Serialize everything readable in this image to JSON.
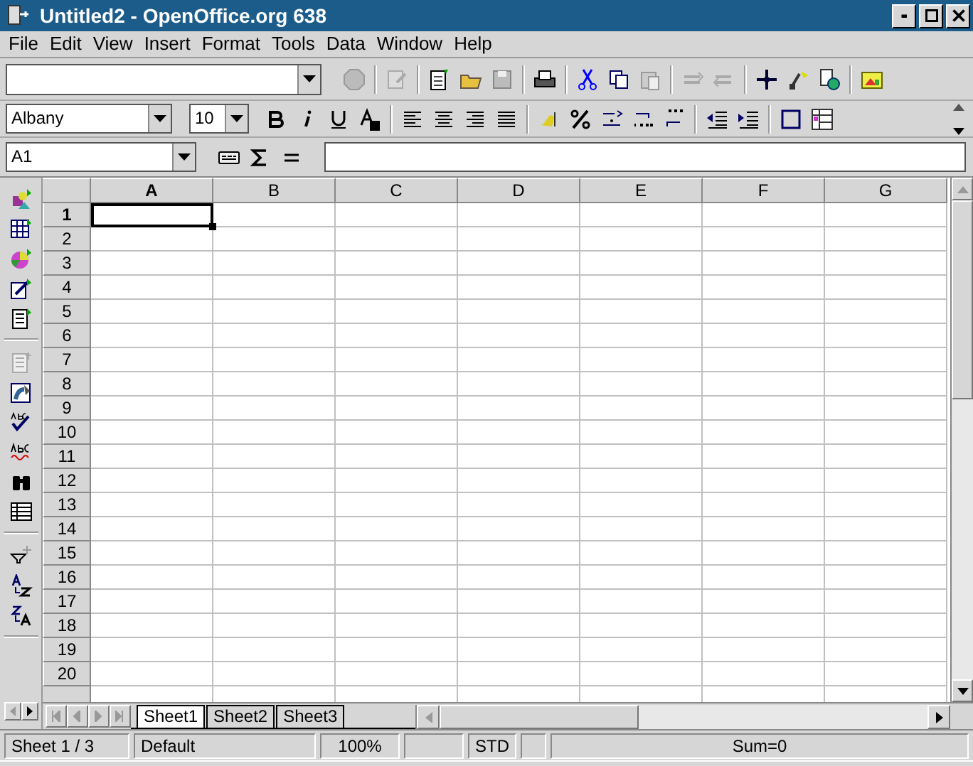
{
  "window": {
    "title": "Untitled2 - OpenOffice.org 638"
  },
  "menu": [
    "File",
    "Edit",
    "View",
    "Insert",
    "Format",
    "Tools",
    "Data",
    "Window",
    "Help"
  ],
  "formatting": {
    "font": "Albany",
    "size": "10"
  },
  "formula_bar": {
    "cell_ref": "A1"
  },
  "sheet": {
    "columns": [
      {
        "label": "A",
        "selected": true
      },
      {
        "label": "B",
        "selected": false
      },
      {
        "label": "C",
        "selected": false
      },
      {
        "label": "D",
        "selected": false
      },
      {
        "label": "E",
        "selected": false
      },
      {
        "label": "F",
        "selected": false
      },
      {
        "label": "G",
        "selected": false
      }
    ],
    "rows": [
      {
        "label": "1",
        "selected": true
      },
      {
        "label": "2",
        "selected": false
      },
      {
        "label": "3",
        "selected": false
      },
      {
        "label": "4",
        "selected": false
      },
      {
        "label": "5",
        "selected": false
      },
      {
        "label": "6",
        "selected": false
      },
      {
        "label": "7",
        "selected": false
      },
      {
        "label": "8",
        "selected": false
      },
      {
        "label": "9",
        "selected": false
      },
      {
        "label": "10",
        "selected": false
      },
      {
        "label": "11",
        "selected": false
      },
      {
        "label": "12",
        "selected": false
      },
      {
        "label": "13",
        "selected": false
      },
      {
        "label": "14",
        "selected": false
      },
      {
        "label": "15",
        "selected": false
      },
      {
        "label": "16",
        "selected": false
      },
      {
        "label": "17",
        "selected": false
      },
      {
        "label": "18",
        "selected": false
      },
      {
        "label": "19",
        "selected": false
      },
      {
        "label": "20",
        "selected": false
      }
    ]
  },
  "sheet_tabs": [
    {
      "label": "Sheet1",
      "selected": true
    },
    {
      "label": "Sheet2",
      "selected": false
    },
    {
      "label": "Sheet3",
      "selected": false
    }
  ],
  "status_bar": [
    "Sheet 1 / 3",
    "Default",
    "100%",
    "STD",
    "Sum=0"
  ]
}
